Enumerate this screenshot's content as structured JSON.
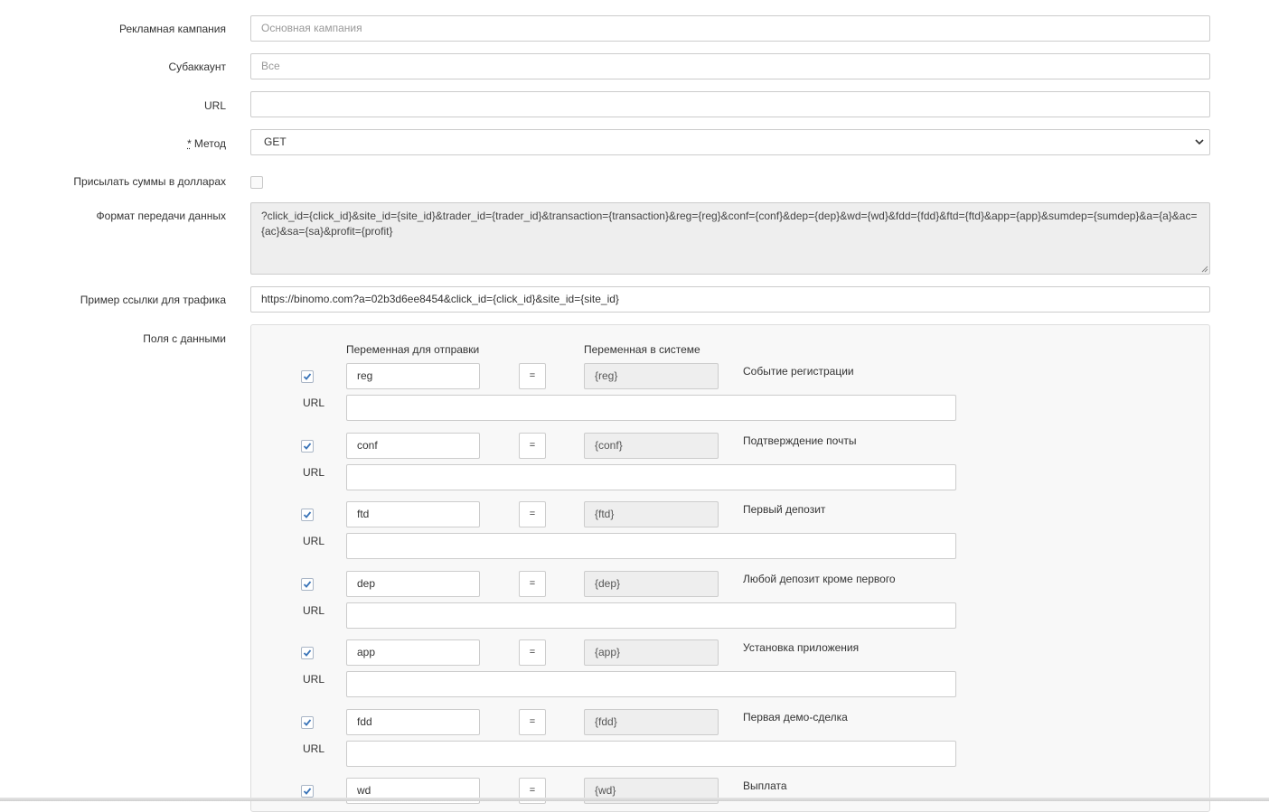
{
  "form": {
    "campaign": {
      "label": "Рекламная кампания",
      "placeholder": "Основная кампания",
      "value": ""
    },
    "subaccount": {
      "label": "Субаккаунт",
      "placeholder": "Все",
      "value": ""
    },
    "url": {
      "label": "URL",
      "value": ""
    },
    "method": {
      "required_mark": "*",
      "label": "Метод",
      "value": "GET"
    },
    "usd": {
      "label": "Присылать суммы в долларах",
      "checked": false
    },
    "format": {
      "label": "Формат передачи данных",
      "value": "?click_id={click_id}&site_id={site_id}&trader_id={trader_id}&transaction={transaction}&reg={reg}&conf={conf}&dep={dep}&wd={wd}&fdd={fdd}&ftd={ftd}&app={app}&sumdep={sumdep}&a={a}&ac={ac}&sa={sa}&profit={profit}"
    },
    "example": {
      "label": "Пример ссылки для трафика",
      "value": "https://binomo.com?a=02b3d6ee8454&click_id={click_id}&site_id={site_id}"
    },
    "fields_label": "Поля с данными"
  },
  "fields_panel": {
    "col_send": "Переменная для отправки",
    "col_system": "Переменная в системе",
    "eq": "=",
    "url_label": "URL",
    "rows": [
      {
        "checked": true,
        "send": "reg",
        "system": "{reg}",
        "desc": "Событие регистрации",
        "url": ""
      },
      {
        "checked": true,
        "send": "conf",
        "system": "{conf}",
        "desc": "Подтверждение почты",
        "url": ""
      },
      {
        "checked": true,
        "send": "ftd",
        "system": "{ftd}",
        "desc": "Первый депозит",
        "url": ""
      },
      {
        "checked": true,
        "send": "dep",
        "system": "{dep}",
        "desc": "Любой депозит кроме первого",
        "url": ""
      },
      {
        "checked": true,
        "send": "app",
        "system": "{app}",
        "desc": "Установка приложения",
        "url": ""
      },
      {
        "checked": true,
        "send": "fdd",
        "system": "{fdd}",
        "desc": "Первая демо-сделка",
        "url": ""
      },
      {
        "checked": true,
        "send": "wd",
        "system": "{wd}",
        "desc": "Выплата",
        "url": ""
      }
    ]
  },
  "colors": {
    "accent_check": "#3a74b8",
    "readonly_bg": "#eeeeee",
    "border": "#cccccc"
  }
}
